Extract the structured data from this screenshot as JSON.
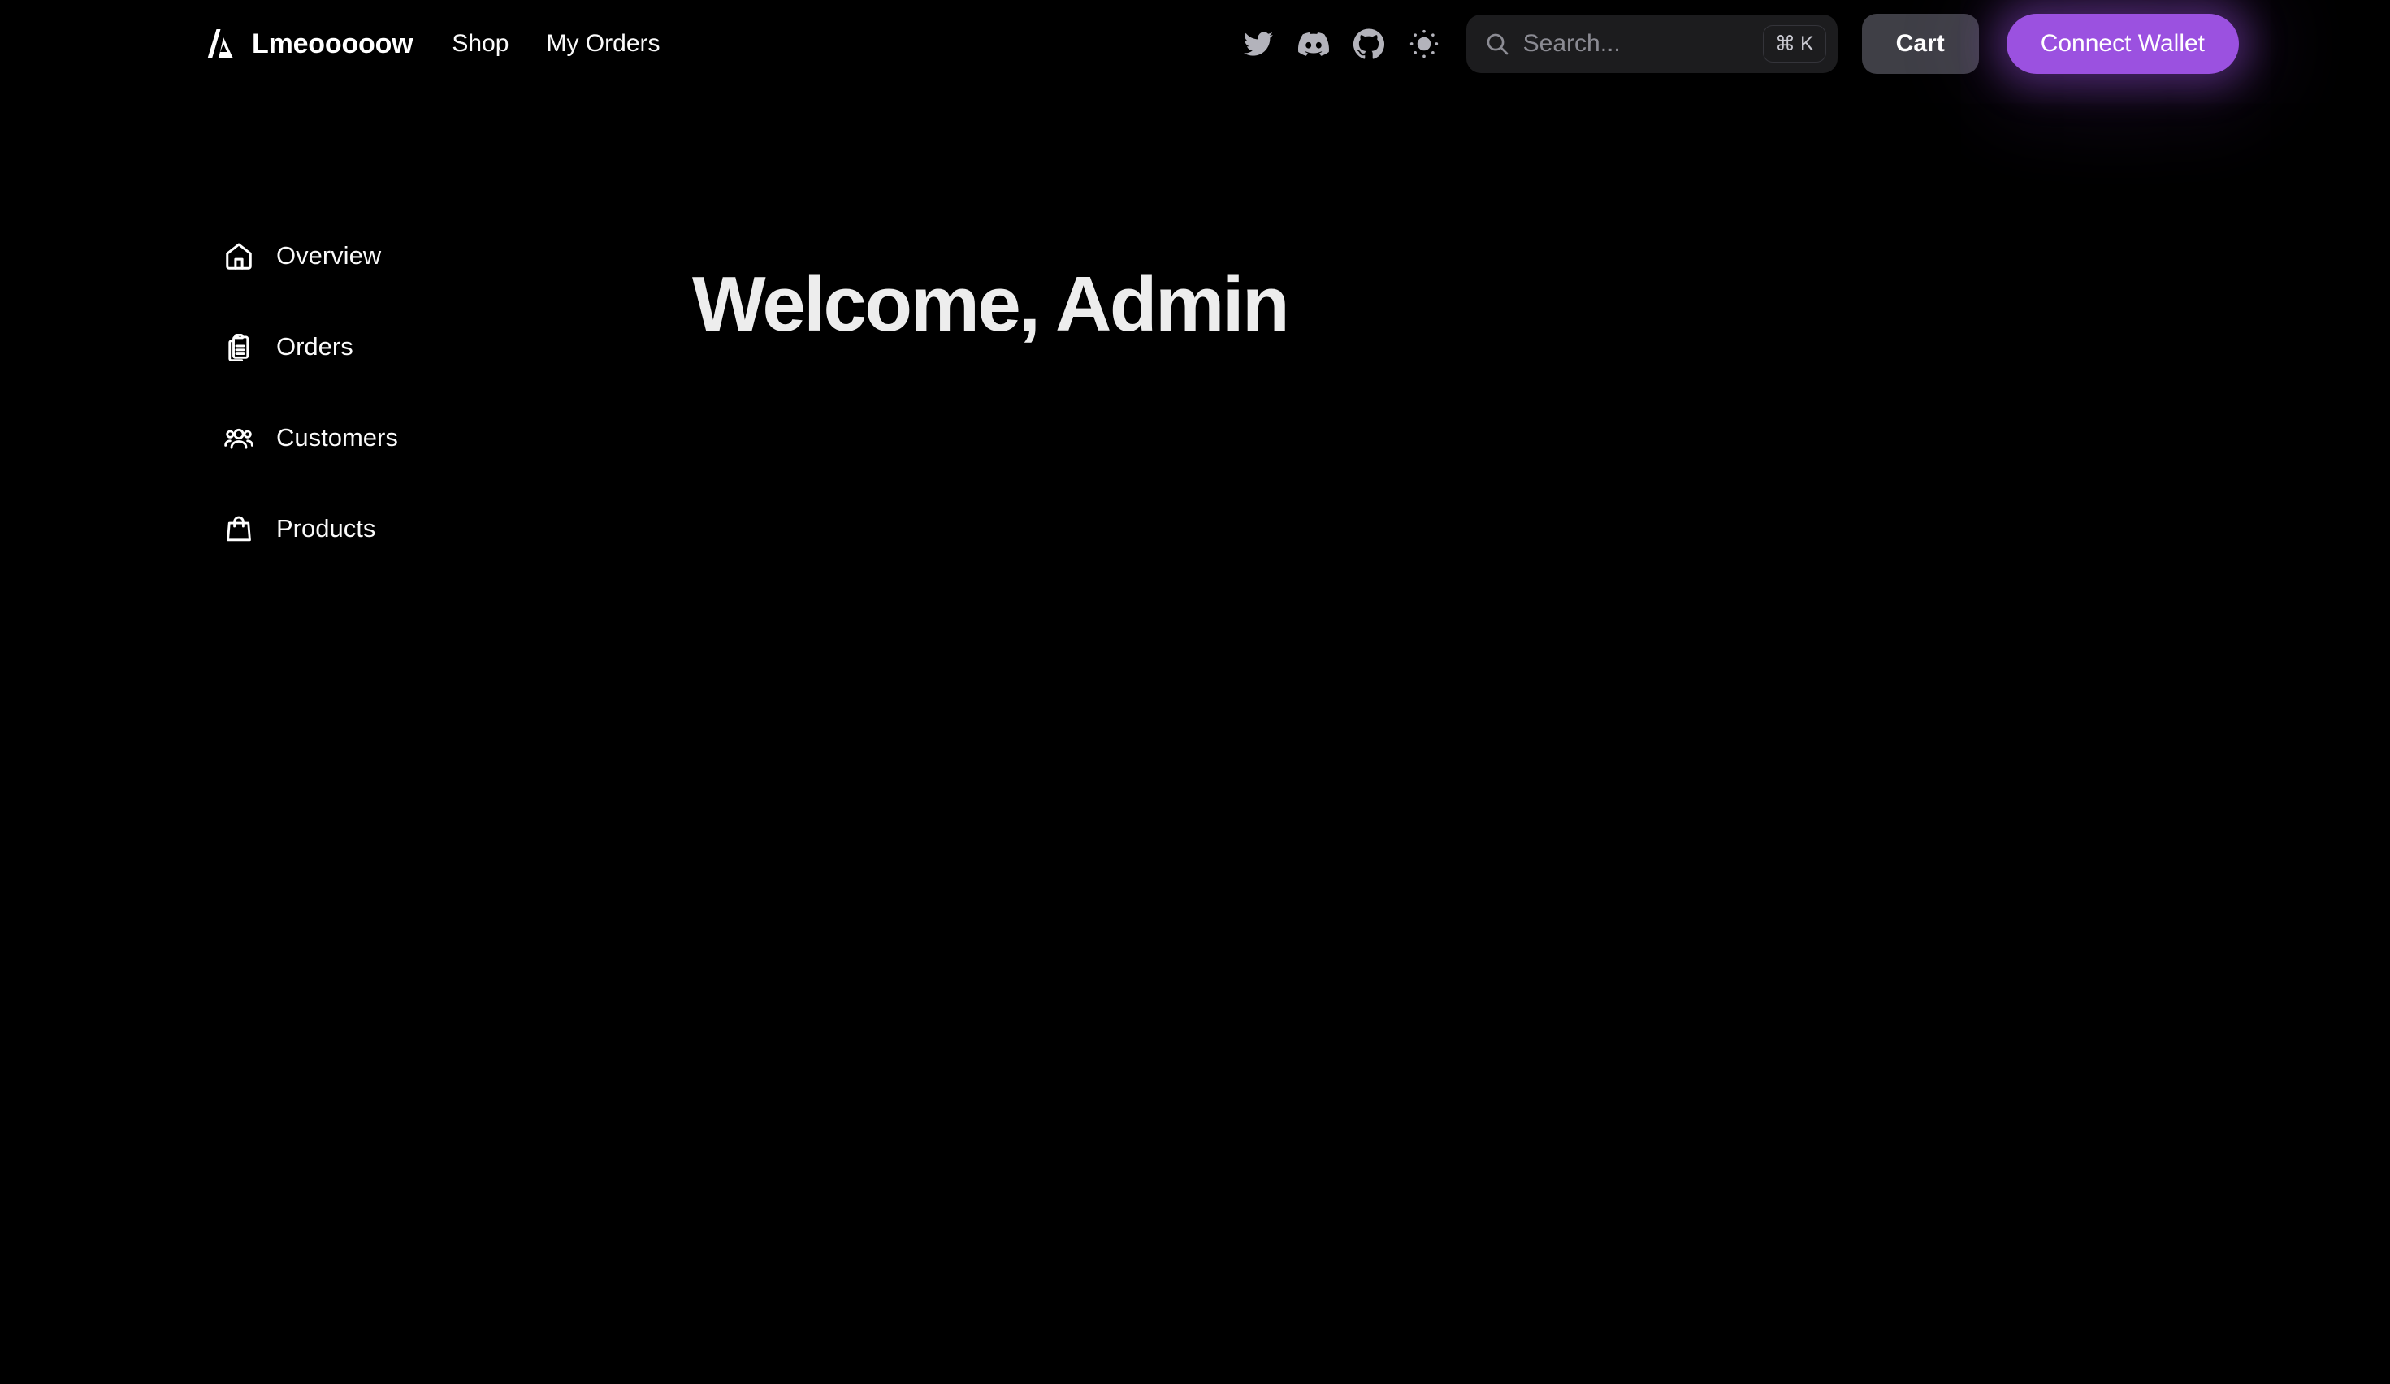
{
  "theme": {
    "background": "#000000",
    "accent": "#9b51e0",
    "surface": "#1c1c1e",
    "surface_alt": "#3f3f46",
    "text": "#fafafa",
    "muted": "#8b8b93"
  },
  "header": {
    "logo_icon": "triangle-slash-logo-icon",
    "brand": "Lmeooooow",
    "nav": [
      {
        "label": "Shop",
        "icon": ""
      },
      {
        "label": "My Orders",
        "icon": ""
      }
    ],
    "social": [
      {
        "name": "twitter-icon",
        "label": "Twitter"
      },
      {
        "name": "discord-icon",
        "label": "Discord"
      },
      {
        "name": "github-icon",
        "label": "GitHub"
      },
      {
        "name": "sun-icon",
        "label": "Toggle theme"
      }
    ],
    "search": {
      "icon": "search-icon",
      "value": "",
      "placeholder": "Search...",
      "shortcut_modifier": "⌘",
      "shortcut_key": "K"
    },
    "cart_label": "Cart",
    "wallet_label": "Connect Wallet"
  },
  "sidebar": {
    "items": [
      {
        "label": "Overview",
        "icon": "home-icon"
      },
      {
        "label": "Orders",
        "icon": "clipboard-list-icon"
      },
      {
        "label": "Customers",
        "icon": "users-icon"
      },
      {
        "label": "Products",
        "icon": "shopping-bag-icon"
      }
    ]
  },
  "main": {
    "title": "Welcome, Admin"
  }
}
